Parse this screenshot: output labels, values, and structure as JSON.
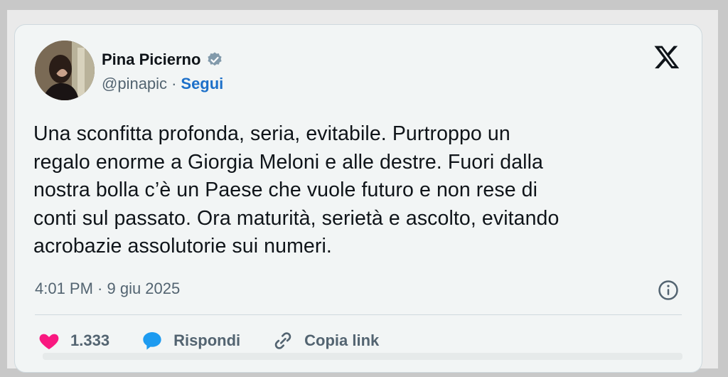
{
  "author": {
    "name": "Pina Picierno",
    "handle": "@pinapic",
    "separator": "·",
    "follow_label": "Segui"
  },
  "tweet": {
    "text": "Una sconfitta profonda, seria, evitabile. Purtroppo un\nregalo enorme a Giorgia Meloni e alle destre. Fuori dalla\nnostra bolla c’è un Paese che vuole futuro e non rese di\nconti sul passato. Ora maturità, serietà e ascolto, evitando\nacrobazie assolutorie sui numeri.",
    "timestamp": "4:01 PM · 9 giu 2025"
  },
  "actions": {
    "like_count": "1.333",
    "reply_label": "Rispondi",
    "copy_label": "Copia link"
  },
  "icons": {
    "verified": "verified-badge-icon",
    "x_logo": "x-logo-icon",
    "info": "info-icon",
    "like": "heart-icon",
    "reply": "speech-bubble-icon",
    "copy": "link-icon"
  },
  "colors": {
    "link": "#1d70c9",
    "like": "#f91880",
    "reply": "#1d9bf0",
    "muted": "#536471"
  }
}
